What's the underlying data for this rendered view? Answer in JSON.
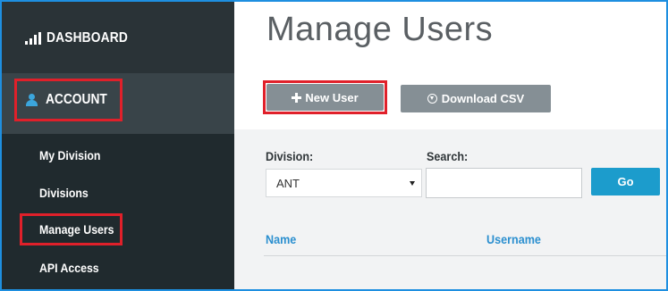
{
  "sidebar": {
    "dashboard_label": "DASHBOARD",
    "dashboard_icon": "bar-chart-icon",
    "account_label": "ACCOUNT",
    "account_icon": "user-icon",
    "subitems": [
      {
        "label": "My Division"
      },
      {
        "label": "Divisions"
      },
      {
        "label": "Manage Users"
      },
      {
        "label": "API Access"
      }
    ]
  },
  "main": {
    "title": "Manage Users",
    "new_user_label": "New User",
    "new_user_icon": "plus-icon",
    "download_csv_label": "Download CSV",
    "download_csv_icon": "download-circle-icon",
    "filters": {
      "division_label": "Division:",
      "division_value": "ANT",
      "search_label": "Search:",
      "search_value": "",
      "go_label": "Go"
    },
    "table": {
      "columns": [
        "Name",
        "Username"
      ]
    }
  },
  "colors": {
    "sidebar_bg": "#2a3337",
    "account_bg": "#394449",
    "subnav_bg": "#202a2e",
    "highlight_border": "#e0202a",
    "go_button": "#1c9ccc",
    "column_header": "#2b8fcf",
    "frame_border": "#1e8fe0"
  }
}
